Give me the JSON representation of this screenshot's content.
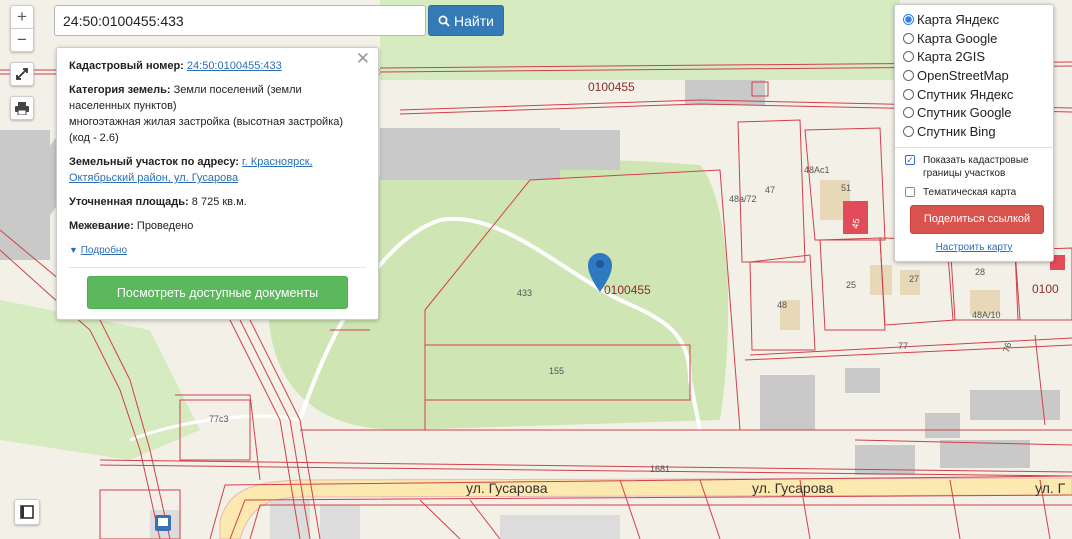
{
  "search": {
    "value": "24:50:0100455:433",
    "button_label": "Найти"
  },
  "zoom": {
    "in_label": "+",
    "out_label": "−"
  },
  "popup": {
    "cadastral_label": "Кадастровый номер:",
    "cadastral_value": "24:50:0100455:433",
    "category_label": "Категория земель:",
    "category_value": "Земли поселений (земли населенных пунктов)",
    "usage_value": "многоэтажная жилая застройка (высотная застройка) (код - 2.6)",
    "address_label": "Земельный участок по адресу:",
    "address_value": "г. Красноярск, Октябрьский район, ул. Гусарова",
    "area_label": "Уточненная площадь:",
    "area_value": "8 725 кв.м.",
    "survey_label": "Межевание:",
    "survey_value": "Проведено",
    "more_label": "Подробно",
    "docs_button": "Посмотреть доступные документы"
  },
  "layers": {
    "options": [
      {
        "label": "Карта Яндекс",
        "selected": true
      },
      {
        "label": "Карта Google",
        "selected": false
      },
      {
        "label": "Карта 2GIS",
        "selected": false
      },
      {
        "label": "OpenStreetMap",
        "selected": false
      },
      {
        "label": "Спутник Яндекс",
        "selected": false
      },
      {
        "label": "Спутник Google",
        "selected": false
      },
      {
        "label": "Спутник Bing",
        "selected": false
      }
    ],
    "show_cadastral_label": "Показать кадастровые границы участков",
    "show_cadastral_checked": true,
    "thematic_label": "Тематическая карта",
    "thematic_checked": false,
    "share_button": "Поделиться ссылкой",
    "setup_link": "Настроить карту"
  },
  "map_labels": {
    "quarter_top": "0100455",
    "quarter_marker": "0100455",
    "quarter_right": "0100",
    "parcel_433": "433",
    "parcel_155": "155",
    "parcel_1681": "1681",
    "parcel_77c3": "77с3",
    "parcel_48a72": "48а/72",
    "parcel_47": "47",
    "parcel_48ac1": "48Ас1",
    "parcel_51": "51",
    "parcel_48": "48",
    "parcel_25": "25",
    "parcel_27": "27",
    "parcel_28": "28",
    "parcel_48a10": "48А/10",
    "parcel_77": "77",
    "parcel_76": "76",
    "building_45": "45",
    "street_left": "ул. Гусарова",
    "street_mid": "ул. Гусарова",
    "street_right": "ул. Г"
  },
  "colors": {
    "parcel_line": "#d0404a",
    "park": "#cfe6b4",
    "road": "#fbe9b0",
    "building": "#c8c8c8",
    "marker": "#2f79c0"
  }
}
